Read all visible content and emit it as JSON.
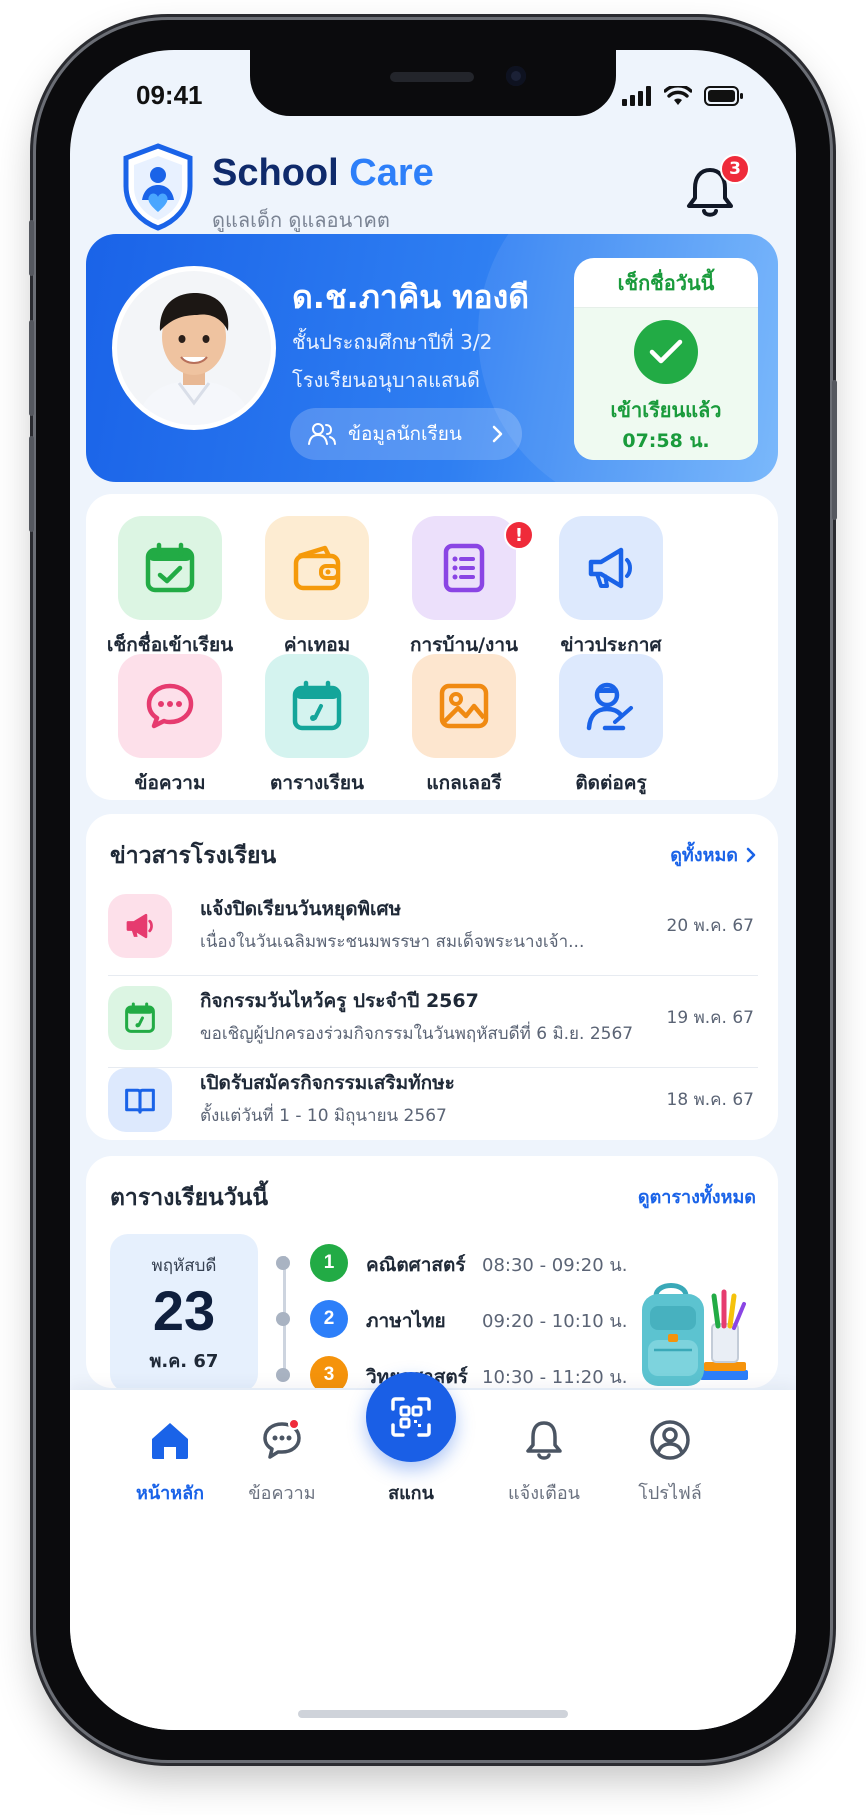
{
  "status_bar": {
    "time": "09:41"
  },
  "header": {
    "app_name_part1": "School",
    "app_name_part2": "Care",
    "tagline": "ดูแลเด็ก ดูแลอนาคต",
    "notification_count": "3"
  },
  "student": {
    "name": "ด.ช.ภาคิน ทองดี",
    "class": "ชั้นประถมศึกษาปีที่ 3/2",
    "school": "โรงเรียนอนุบาลแสนดี",
    "info_button": "ข้อมูลนักเรียน"
  },
  "checkin": {
    "title": "เช็กชื่อวันนี้",
    "status": "เข้าเรียนแล้ว",
    "time": "07:58 น."
  },
  "menu": {
    "items": [
      {
        "label": "เช็กชื่อเข้าเรียน",
        "icon": "calendar-check-icon"
      },
      {
        "label": "ค่าเทอม",
        "icon": "wallet-icon"
      },
      {
        "label": "การบ้าน/งาน",
        "icon": "document-list-icon",
        "alert": "!"
      },
      {
        "label": "ข่าวประกาศ",
        "icon": "megaphone-icon"
      },
      {
        "label": "ข้อความ",
        "icon": "chat-bubble-icon"
      },
      {
        "label": "ตารางเรียน",
        "icon": "calendar-icon"
      },
      {
        "label": "แกลเลอรี",
        "icon": "image-icon"
      },
      {
        "label": "ติดต่อครู",
        "icon": "teacher-icon"
      }
    ]
  },
  "news": {
    "title": "ข่าวสารโรงเรียน",
    "see_all": "ดูทั้งหมด",
    "items": [
      {
        "title": "แจ้งปิดเรียนวันหยุดพิเศษ",
        "desc": "เนื่องในวันเฉลิมพระชนมพรรษา สมเด็จพระนางเจ้า...",
        "date": "20 พ.ค. 67",
        "icon": "megaphone-icon"
      },
      {
        "title": "กิจกรรมวันไหว้ครู ประจำปี 2567",
        "desc": "ขอเชิญผู้ปกครองร่วมกิจกรรมในวันพฤหัสบดีที่ 6 มิ.ย. 2567",
        "date": "19 พ.ค. 67",
        "icon": "calendar-icon"
      },
      {
        "title": "เปิดรับสมัครกิจกรรมเสริมทักษะ",
        "desc": "ตั้งแต่วันที่ 1 - 10 มิถุนายน 2567",
        "date": "18 พ.ค. 67",
        "icon": "book-icon"
      }
    ]
  },
  "schedule": {
    "title": "ตารางเรียนวันนี้",
    "see_all": "ดูตารางทั้งหมด",
    "day_name": "พฤหัสบดี",
    "day_number": "23",
    "month_year": "พ.ค. 67",
    "items": [
      {
        "number": "1",
        "subject": "คณิตศาสตร์",
        "time": "08:30 - 09:20 น.",
        "color": "#22ab45"
      },
      {
        "number": "2",
        "subject": "ภาษาไทย",
        "time": "09:20 - 10:10 น.",
        "color": "#2d7ff9"
      },
      {
        "number": "3",
        "subject": "วิทยาศาสตร์",
        "time": "10:30 - 11:20 น.",
        "color": "#f5930b"
      }
    ]
  },
  "bottom_nav": {
    "home": "หน้าหลัก",
    "messages": "ข้อความ",
    "scan": "สแกน",
    "notifications": "แจ้งเตือน",
    "profile": "โปรไฟล์"
  },
  "colors": {
    "primary": "#1a63e8",
    "success": "#22ab45",
    "alert": "#ef2b3a",
    "background": "#eef4fc"
  }
}
